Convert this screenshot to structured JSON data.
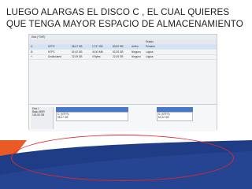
{
  "slide": {
    "title": "LUEGO ALARGAS EL DISCO C , EL CUAL QUIERES QUE TENGA MAYOR ESPACIO  DE ALMACENAMIENTO"
  },
  "screenshot": {
    "window_title": "Disk (*ТМП)",
    "columns": [
      "",
      "",
      "",
      "",
      "",
      "",
      "Estado",
      ""
    ],
    "rows": [
      [
        "C:",
        "NTFS",
        "98,47 GB",
        "17,97 GB",
        "80,50 GB",
        "Activo",
        "Primario",
        ""
      ],
      [
        "D:",
        "NTFS",
        "52,42 GB",
        "44,53 MB",
        "52,39 GB",
        "Ninguno",
        "Lógica",
        ""
      ],
      [
        "*:",
        "Unallocated",
        "22,49 GB",
        "0 Bytes",
        "22,49 GB",
        "Ninguno",
        "Lógica",
        ""
      ]
    ],
    "disk": {
      "name": "Disk 1",
      "type": "Basic MBR",
      "size": "149,05 GB",
      "partition_c": {
        "label": "C: (NTFS)",
        "size": "98,47 GB"
      },
      "partition_d": {
        "label": "D: (NTFS)",
        "size": "52,42 GB"
      }
    }
  },
  "colors": {
    "accent_orange": "#ea5a24",
    "accent_navy": "#1f3c86",
    "highlight_circle": "#e0282f",
    "partition_bar": "#4a78c8"
  }
}
